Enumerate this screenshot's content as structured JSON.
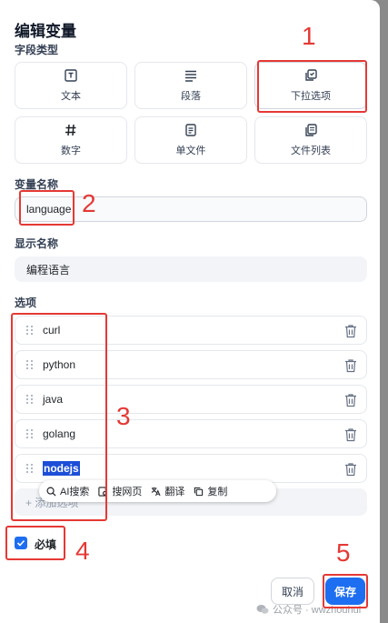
{
  "dialog": {
    "title": "编辑变量"
  },
  "field_type": {
    "label": "字段类型",
    "options": [
      {
        "label": "文本",
        "icon": "text-box-icon"
      },
      {
        "label": "段落",
        "icon": "paragraph-icon"
      },
      {
        "label": "下拉选项",
        "icon": "dropdown-select-icon",
        "selected": true
      },
      {
        "label": "数字",
        "icon": "hash-icon"
      },
      {
        "label": "单文件",
        "icon": "file-icon"
      },
      {
        "label": "文件列表",
        "icon": "file-list-icon"
      }
    ]
  },
  "variable_name": {
    "label": "变量名称",
    "value": "language"
  },
  "display_name": {
    "label": "显示名称",
    "value": "编程语言"
  },
  "options_section": {
    "label": "选项",
    "items": [
      "curl",
      "python",
      "java",
      "golang",
      "nodejs"
    ],
    "add_placeholder": "+ 添加选项"
  },
  "selection_popup": {
    "items": [
      {
        "label": "AI搜索",
        "icon": "search-icon"
      },
      {
        "label": "搜网页",
        "icon": "web-search-icon"
      },
      {
        "label": "翻译",
        "icon": "translate-icon"
      },
      {
        "label": "复制",
        "icon": "copy-icon"
      }
    ]
  },
  "required": {
    "label": "必填",
    "checked": true
  },
  "buttons": {
    "cancel": "取消",
    "save": "保存"
  },
  "annotations": [
    "1",
    "2",
    "3",
    "4",
    "5"
  ],
  "watermark": "公众号 · wwzhouhui",
  "colors": {
    "primary": "#1d6ef0",
    "annotation": "#e53935",
    "selection": "#1d4ed8"
  }
}
